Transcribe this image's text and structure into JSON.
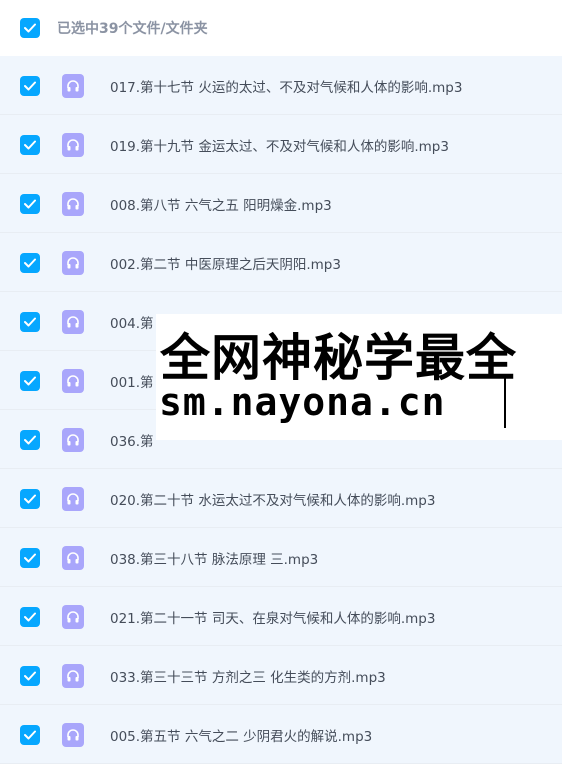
{
  "header": {
    "title": "已选中39个文件/文件夹",
    "checked": true
  },
  "files": [
    {
      "name": "017.第十七节 火运的太过、不及对气候和人体的影响.mp3",
      "icon": "audio-file-icon"
    },
    {
      "name": "019.第十九节 金运太过、不及对气候和人体的影响.mp3",
      "icon": "audio-file-icon"
    },
    {
      "name": "008.第八节 六气之五 阳明燥金.mp3",
      "icon": "audio-file-icon"
    },
    {
      "name": "002.第二节 中医原理之后天阴阳.mp3",
      "icon": "audio-file-icon"
    },
    {
      "name": "004.第",
      "icon": "audio-file-icon"
    },
    {
      "name": "001.第",
      "icon": "audio-file-icon"
    },
    {
      "name": "036.第",
      "icon": "audio-file-icon"
    },
    {
      "name": "020.第二十节 水运太过不及对气候和人体的影响.mp3",
      "icon": "audio-file-icon"
    },
    {
      "name": "038.第三十八节 脉法原理 三.mp3",
      "icon": "audio-file-icon"
    },
    {
      "name": "021.第二十一节 司天、在泉对气候和人体的影响.mp3",
      "icon": "audio-file-icon"
    },
    {
      "name": "033.第三十三节 方剂之三 化生类的方剂.mp3",
      "icon": "audio-file-icon"
    },
    {
      "name": "005.第五节 六气之二 少阴君火的解说.mp3",
      "icon": "audio-file-icon"
    }
  ],
  "watermark": {
    "line1": "全网神秘学最全",
    "line2": "sm.nayona.cn"
  },
  "colors": {
    "accent": "#06a7ff",
    "file_icon": "#a9a6fb",
    "row_bg": "#f0f6fd"
  }
}
